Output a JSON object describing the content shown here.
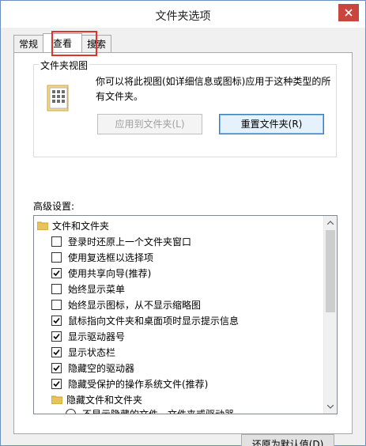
{
  "window": {
    "title": "文件夹选项"
  },
  "tabs": [
    {
      "label": "常规",
      "active": false
    },
    {
      "label": "查看",
      "active": true
    },
    {
      "label": "搜索",
      "active": false
    }
  ],
  "folder_views": {
    "legend": "文件夹视图",
    "description": "你可以将此视图(如详细信息或图标)应用于这种类型的所有文件夹。",
    "apply_button": "应用到文件夹(L)",
    "reset_button": "重置文件夹(R)"
  },
  "advanced": {
    "label": "高级设置:",
    "items": [
      {
        "type": "folder",
        "label": "文件和文件夹"
      },
      {
        "type": "checkbox",
        "label": "登录时还原上一个文件夹窗口",
        "checked": false
      },
      {
        "type": "checkbox",
        "label": "使用复选框以选择项",
        "checked": false
      },
      {
        "type": "checkbox",
        "label": "使用共享向导(推荐)",
        "checked": true
      },
      {
        "type": "checkbox",
        "label": "始终显示菜单",
        "checked": false
      },
      {
        "type": "checkbox",
        "label": "始终显示图标，从不显示缩略图",
        "checked": false
      },
      {
        "type": "checkbox",
        "label": "鼠标指向文件夹和桌面项时显示提示信息",
        "checked": true
      },
      {
        "type": "checkbox",
        "label": "显示驱动器号",
        "checked": true
      },
      {
        "type": "checkbox",
        "label": "显示状态栏",
        "checked": true
      },
      {
        "type": "checkbox",
        "label": "隐藏空的驱动器",
        "checked": true
      },
      {
        "type": "checkbox",
        "label": "隐藏受保护的操作系统文件(推荐)",
        "checked": true
      },
      {
        "type": "folder",
        "label": "隐藏文件和文件夹"
      },
      {
        "type": "radio",
        "label": "不显示隐藏的文件、文件夹或驱动器",
        "checked": false
      }
    ]
  },
  "restore_defaults_button": "还原为默认值(D)",
  "colors": {
    "accent_highlight": "#e0332a",
    "close_button": "#c9453d"
  }
}
